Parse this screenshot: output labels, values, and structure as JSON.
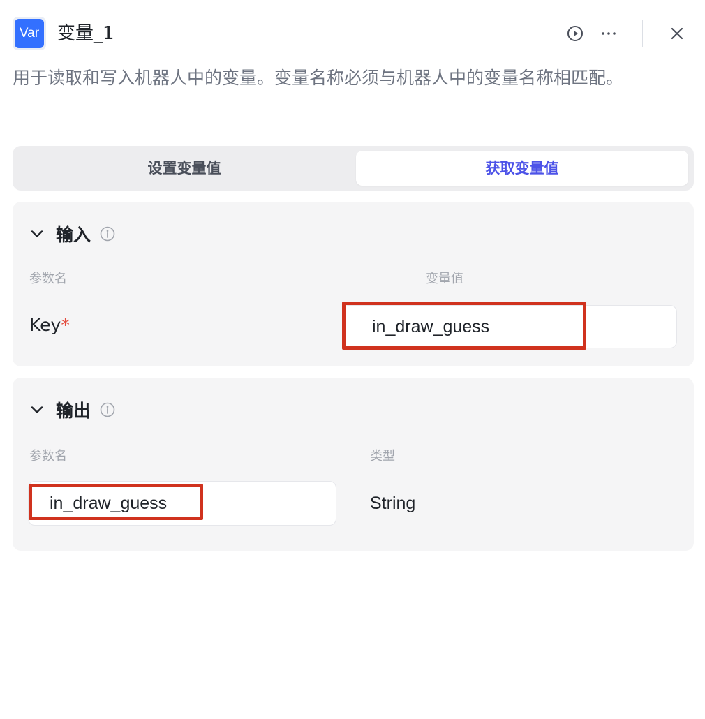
{
  "header": {
    "badge_text": "Var",
    "badge_color": "#3370ff",
    "title": "变量_1",
    "icons": [
      "play-circle-icon",
      "more-horizontal-icon",
      "close-icon"
    ]
  },
  "description": "用于读取和写入机器人中的变量。变量名称必须与机器人中的变量名称相匹配。",
  "tabs": [
    {
      "label": "设置变量值",
      "active": false
    },
    {
      "label": "获取变量值",
      "active": true
    }
  ],
  "accent_color": "#4d53e8",
  "highlight_color": "#d0321e",
  "input_section": {
    "title": "输入",
    "col_param": "参数名",
    "col_value": "变量值",
    "key_label": "Key",
    "required_mark": "*",
    "value": "in_draw_guess"
  },
  "output_section": {
    "title": "输出",
    "col_param": "参数名",
    "col_type": "类型",
    "param_value": "in_draw_guess",
    "type_value": "String"
  }
}
